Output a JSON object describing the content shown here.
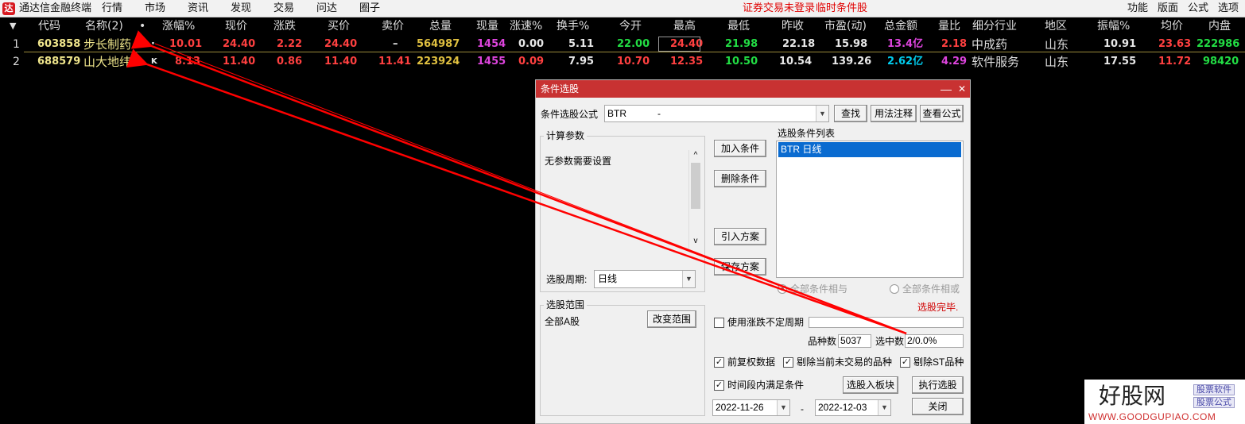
{
  "app": {
    "title": "通达信金融终端",
    "menu": [
      "行情",
      "市场",
      "资讯",
      "发现",
      "交易",
      "问达",
      "圈子"
    ],
    "status_login": "证券交易未登录",
    "status_mode": "临时条件股",
    "right_menu": [
      "功能",
      "版面",
      "公式",
      "选项"
    ]
  },
  "table": {
    "sort_icon": "triangle-down-icon",
    "columns": [
      "代码",
      "名称(2)",
      "•",
      "涨幅%",
      "现价",
      "涨跌",
      "买价",
      "卖价",
      "总量",
      "现量",
      "涨速%",
      "换手%",
      "今开",
      "最高",
      "最低",
      "昨收",
      "市盈(动)",
      "总金额",
      "量比",
      "细分行业",
      "地区",
      "振幅%",
      "均价",
      "内盘"
    ],
    "rows": [
      {
        "idx": "1",
        "code": "603858",
        "name": "步长制药",
        "flag": "·",
        "chg_pct": "10.01",
        "price": "24.40",
        "chg": "2.22",
        "bid": "24.40",
        "ask": "–",
        "vol": "564987",
        "cur_vol": "1454",
        "speed": "0.00",
        "turnover": "5.11",
        "open": "22.00",
        "high": "24.40",
        "low": "21.98",
        "prev": "22.18",
        "pe": "15.98",
        "amount": "13.4亿",
        "vol_ratio": "2.18",
        "industry": "中成药",
        "region": "山东",
        "amplitude": "10.91",
        "avg": "23.63",
        "inner": "222986"
      },
      {
        "idx": "2",
        "code": "688579",
        "name": "山大地纬",
        "flag": "K",
        "chg_pct": "8.13",
        "price": "11.40",
        "chg": "0.86",
        "bid": "11.40",
        "ask": "11.41",
        "vol": "223924",
        "cur_vol": "1455",
        "speed": "0.09",
        "turnover": "7.95",
        "open": "10.70",
        "high": "12.35",
        "low": "10.50",
        "prev": "10.54",
        "pe": "139.26",
        "amount": "2.62亿",
        "vol_ratio": "4.29",
        "industry": "软件服务",
        "region": "山东",
        "amplitude": "17.55",
        "avg": "11.72",
        "inner": "98420"
      }
    ]
  },
  "dialog": {
    "title": "条件选股",
    "formula_label": "条件选股公式",
    "formula_value": "BTR",
    "formula_desc": "-",
    "find_btn": "查找",
    "usage_btn": "用法注释",
    "view_btn": "查看公式",
    "params_group": "计算参数",
    "params_text": "无参数需要设置",
    "add_btn": "加入条件",
    "del_btn": "删除条件",
    "import_btn": "引入方案",
    "save_btn": "保存方案",
    "cond_list_label": "选股条件列表",
    "cond_list": [
      "BTR  日线"
    ],
    "period_label": "选股周期:",
    "period_value": "日线",
    "radio_and": "全部条件相与",
    "radio_or": "全部条件相或",
    "result_status": "选股完毕.",
    "range_group": "选股范围",
    "range_value": "全部A股",
    "change_range_btn": "改变范围",
    "use_period_label": "使用涨跌不定周期",
    "count_label": "品种数",
    "count_value": "5037",
    "selected_label": "选中数",
    "selected_value": "2/0.0%",
    "cb_adjust": "前复权数据",
    "cb_exclude_untraded": "剔除当前未交易的品种",
    "cb_exclude_st": "剔除ST品种",
    "cb_time_range": "时间段内满足条件",
    "to_block_btn": "选股入板块",
    "run_btn": "执行选股",
    "date_from": "2022-11-26",
    "date_sep": "-",
    "date_to": "2022-12-03",
    "close_btn": "关闭",
    "minimize": "—",
    "close_x": "✕"
  },
  "watermark": {
    "brand": "好股网",
    "tag1": "股票软件",
    "tag2": "股票公式",
    "url": "WWW.GOODGUPIAO.COM"
  },
  "colors": {
    "title_bar": "#c83232",
    "arrow": "#ff0000",
    "selection": "#0a6bd0"
  }
}
